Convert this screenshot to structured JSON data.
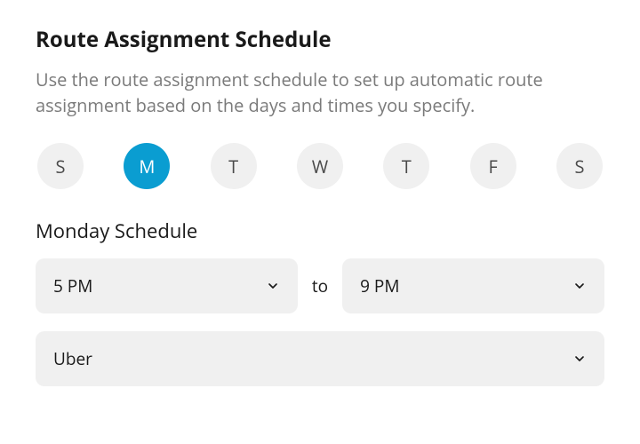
{
  "header": {
    "title": "Route Assignment Schedule",
    "description": "Use the route assignment schedule to set up automatic route assignment based on the days and times you specify."
  },
  "days": [
    {
      "label": "S",
      "name": "sunday",
      "active": false
    },
    {
      "label": "M",
      "name": "monday",
      "active": true
    },
    {
      "label": "T",
      "name": "tuesday",
      "active": false
    },
    {
      "label": "W",
      "name": "wednesday",
      "active": false
    },
    {
      "label": "T",
      "name": "thursday",
      "active": false
    },
    {
      "label": "F",
      "name": "friday",
      "active": false
    },
    {
      "label": "S",
      "name": "saturday",
      "active": false
    }
  ],
  "schedule": {
    "title": "Monday Schedule",
    "start_time": "5 PM",
    "to_label": "to",
    "end_time": "9 PM",
    "service": "Uber"
  }
}
